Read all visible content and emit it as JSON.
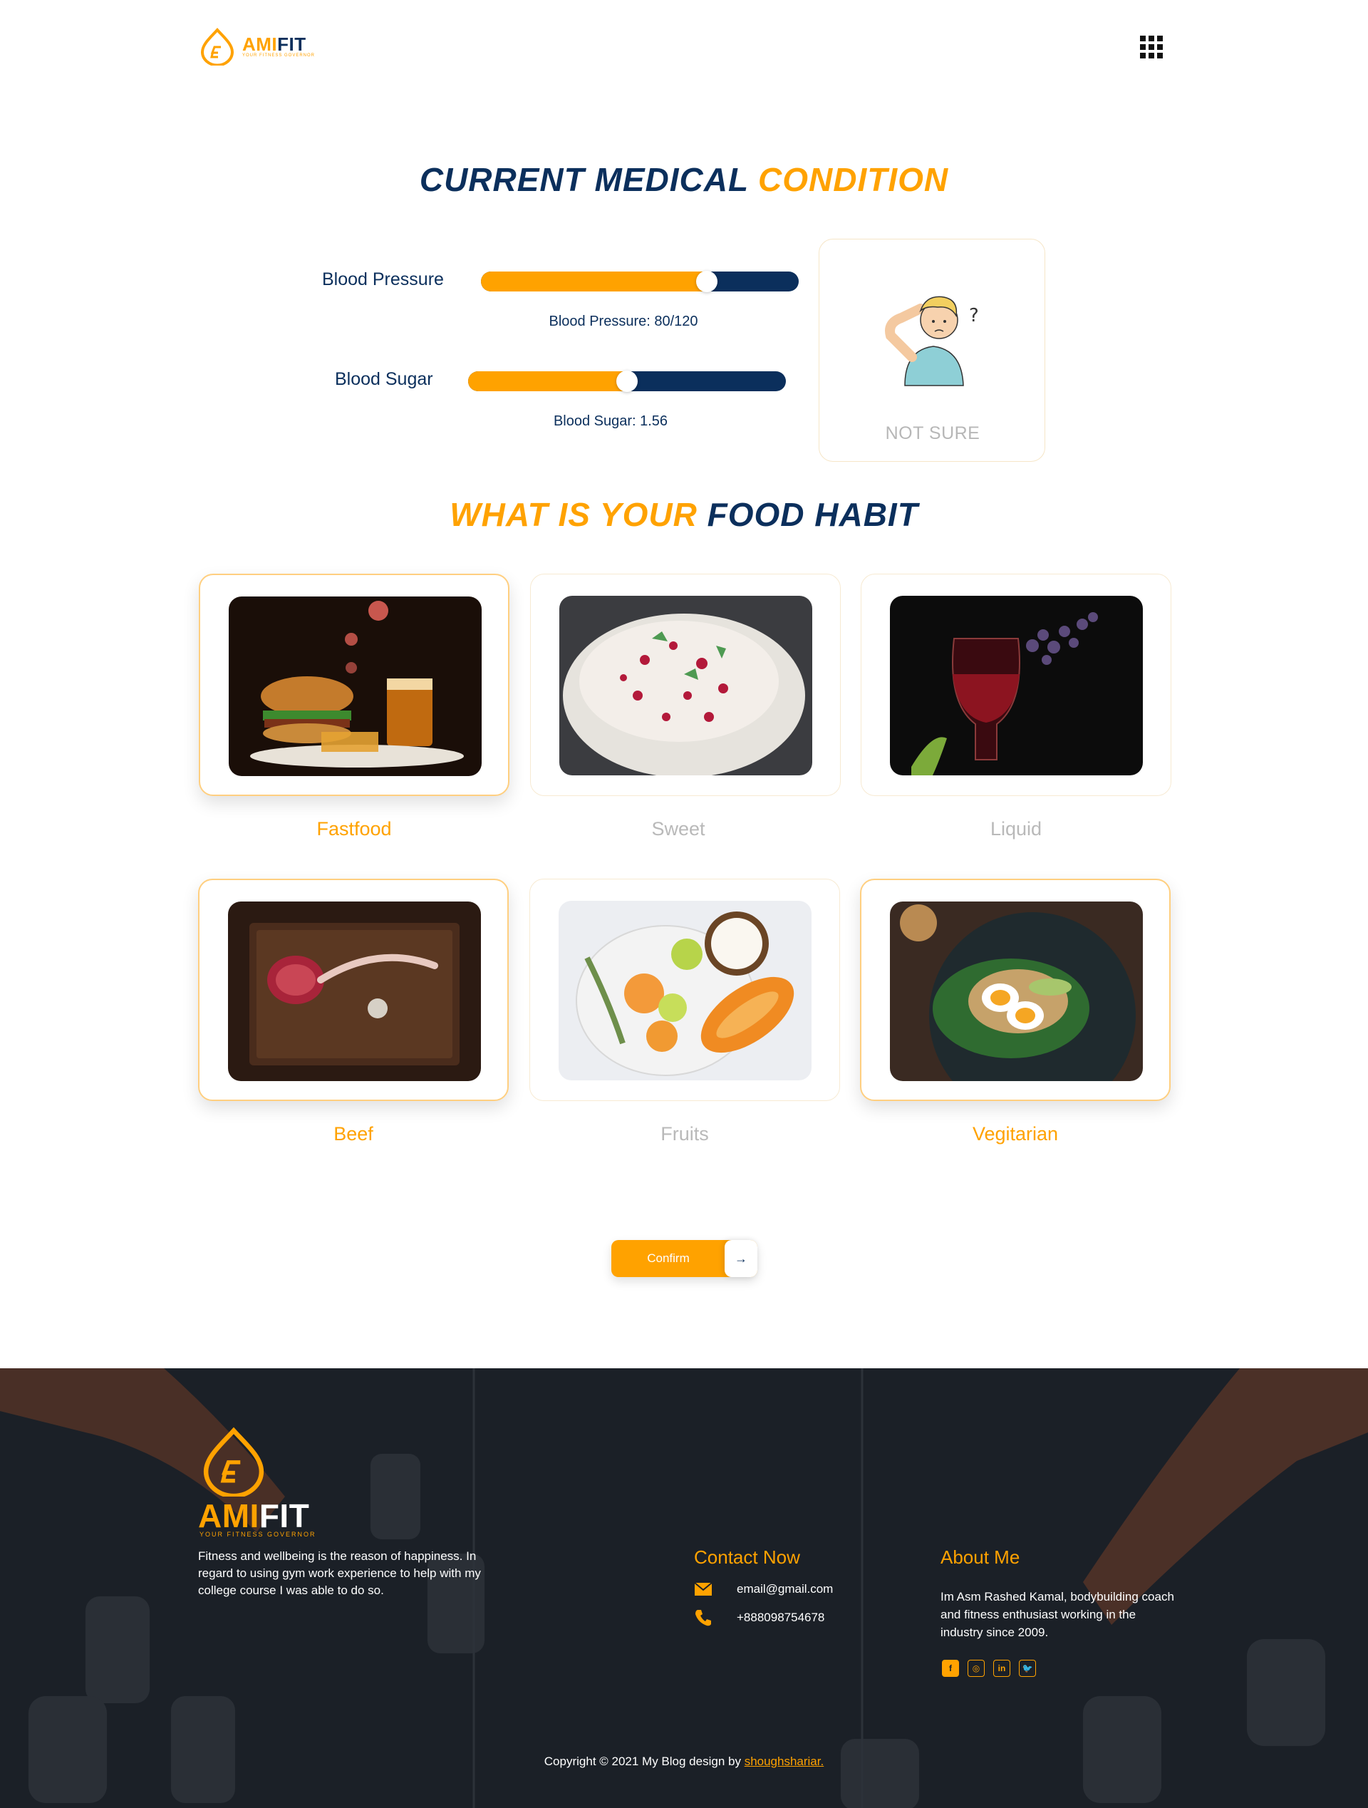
{
  "header": {
    "logo_ami": "AMI",
    "logo_fit": "FIT",
    "logo_tagline": "YOUR FITNESS GOVERNOR",
    "menu_icon": "grid-menu-icon"
  },
  "medical": {
    "title_part1": "CURRENT MEDICAL",
    "title_part2": "CONDITION",
    "blood_pressure": {
      "label": "Blood Pressure",
      "readout": "Blood Pressure: 80/120",
      "level": 0.71
    },
    "blood_sugar": {
      "label": "Blood Sugar",
      "readout": "Blood Sugar: 1.56",
      "level": 0.5
    },
    "not_sure": {
      "label": "NOT SURE",
      "icon": "confused-person-icon"
    }
  },
  "food": {
    "title_part1": "WHAT IS YOUR",
    "title_part2": "FOOD HABIT",
    "items": [
      {
        "label": "Fastfood",
        "selected": true
      },
      {
        "label": "Sweet",
        "selected": false
      },
      {
        "label": "Liquid",
        "selected": false
      },
      {
        "label": "Beef",
        "selected": true
      },
      {
        "label": "Fruits",
        "selected": false
      },
      {
        "label": "Vegitarian",
        "selected": true
      }
    ]
  },
  "confirm": {
    "label": "Confirm",
    "arrow": "→"
  },
  "footer": {
    "logo_ami": "AMI",
    "logo_fit": "FIT",
    "logo_tagline": "YOUR FITNESS GOVERNOR",
    "description": "Fitness and wellbeing is the reason of happiness. In regard to using gym work experience to help with my college course I was able to do so.",
    "contact_heading": "Contact Now",
    "email": "email@gmail.com",
    "phone": "+888098754678",
    "about_heading": "About Me",
    "about_text": "Im Asm Rashed Kamal, bodybuilding coach and fitness enthusiast working in the industry since 2009.",
    "socials": [
      {
        "label": "f",
        "icon": "facebook-icon"
      },
      {
        "label": "◎",
        "icon": "instagram-icon"
      },
      {
        "label": "in",
        "icon": "linkedin-icon"
      },
      {
        "label": "🐦",
        "icon": "twitter-icon"
      }
    ],
    "copyright_text": "Copyright © 2021 My Blog design by ",
    "copyright_link": "shoughshariar."
  },
  "colors": {
    "accent": "#ffa200",
    "navy": "#0b2f5c",
    "footer_bg": "#1b2027"
  }
}
